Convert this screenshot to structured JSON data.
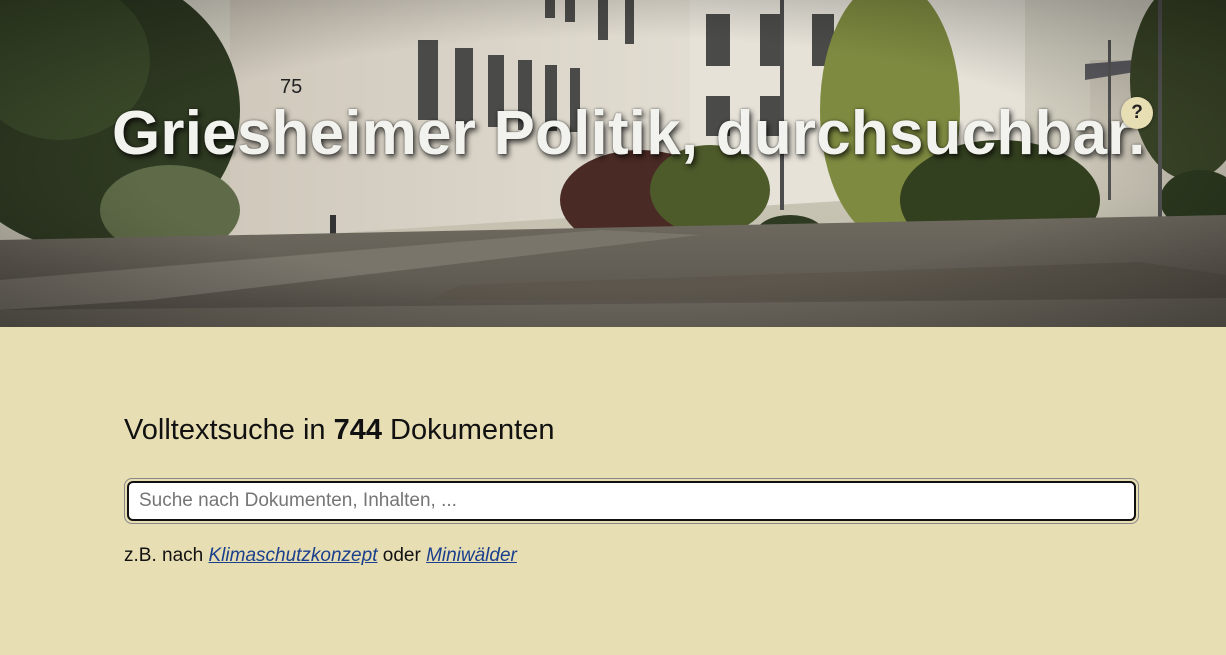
{
  "hero": {
    "title": "Griesheimer Politik, durchsuchbar.",
    "building_number": "75",
    "help_label": "?"
  },
  "search": {
    "heading_prefix": "Volltextsuche in ",
    "document_count": "744",
    "heading_suffix": " Dokumenten",
    "placeholder": "Suche nach Dokumenten, Inhalten, ...",
    "value": ""
  },
  "examples": {
    "prefix": "z.B. nach ",
    "link1": "Klimaschutzkonzept",
    "connector": " oder ",
    "link2": "Miniwälder"
  },
  "colors": {
    "page_background": "#e8deb4",
    "link": "#1a3f8c",
    "title_text": "#f2f2ee"
  }
}
